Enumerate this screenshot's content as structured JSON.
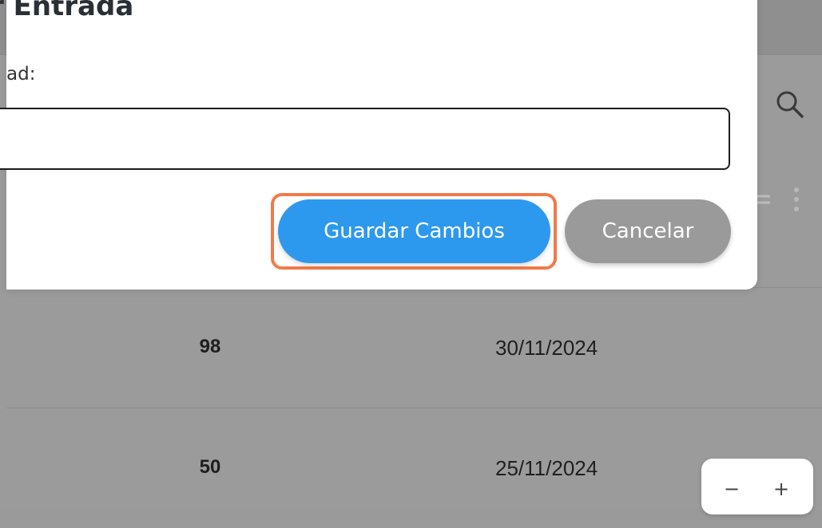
{
  "modal": {
    "title": "r Entrada",
    "field_label": "ad:",
    "field_value": "",
    "field_placeholder": "",
    "save_label": "Guardar Cambios",
    "cancel_label": "Cancelar"
  },
  "table": {
    "rows": [
      {
        "quantity": "98",
        "date": "30/11/2024"
      },
      {
        "quantity": "50",
        "date": "25/11/2024"
      }
    ]
  },
  "zoom": {
    "minus_label": "−",
    "plus_label": "+"
  },
  "icons": {
    "search": "search-icon",
    "menu": "more-vert-icon",
    "equals": "equals-icon"
  },
  "colors": {
    "primary": "#2d99ee",
    "secondary": "#9a9a9a",
    "highlight": "#f07a4a",
    "overlay": "#9b9b9b"
  }
}
